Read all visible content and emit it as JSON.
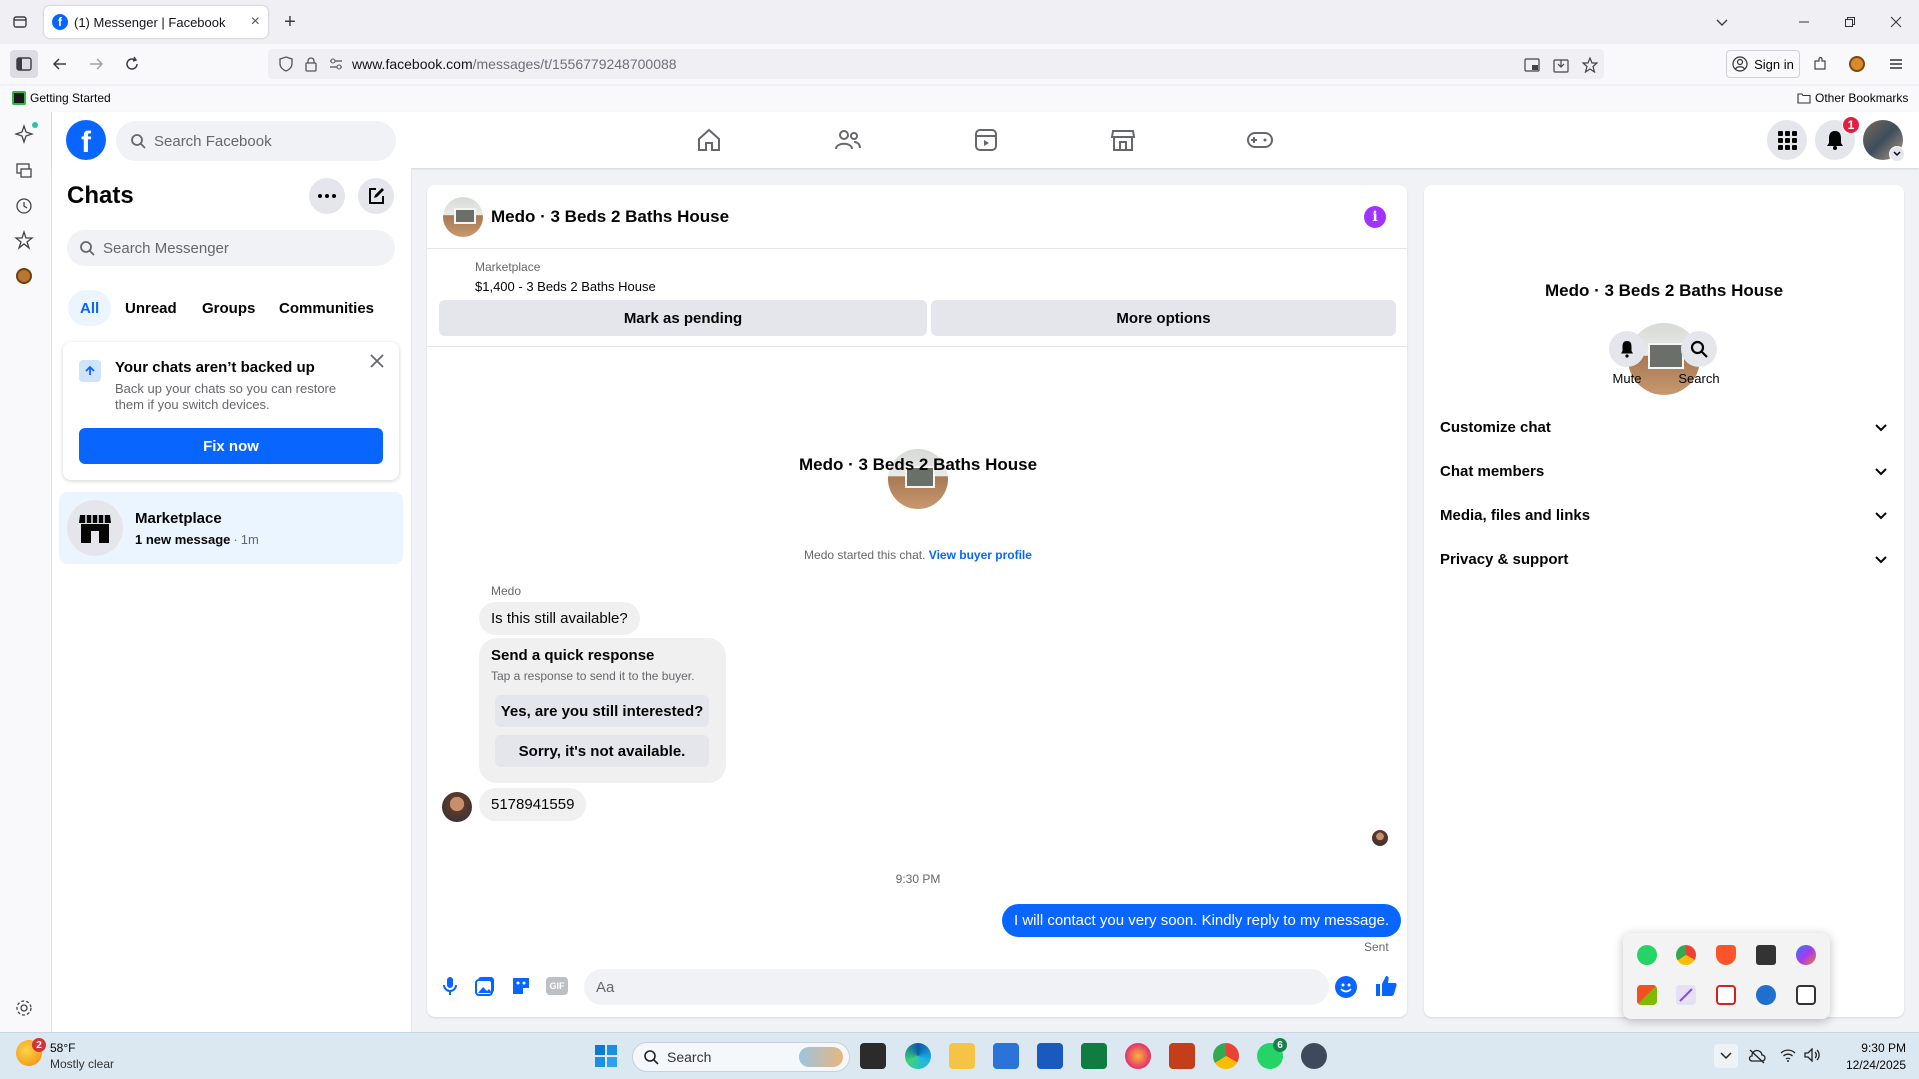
{
  "browser": {
    "tab_title": "(1) Messenger | Facebook",
    "url_host": "www.facebook.com",
    "url_path": "/messages/t/1556779248700088",
    "sign_in": "Sign in",
    "bookmark_getting_started": "Getting Started",
    "bookmark_other": "Other Bookmarks"
  },
  "fb_header": {
    "search_placeholder": "Search Facebook",
    "notification_count": "1"
  },
  "chats": {
    "title": "Chats",
    "search_placeholder": "Search Messenger",
    "filters": [
      "All",
      "Unread",
      "Groups",
      "Communities"
    ],
    "active_filter": "All",
    "backup": {
      "title": "Your chats aren’t backed up",
      "body": "Back up your chats so you can restore them if you switch devices.",
      "button": "Fix now"
    },
    "list": [
      {
        "name": "Marketplace",
        "preview": "1 new message",
        "time": "1m"
      }
    ]
  },
  "conversation": {
    "title": "Medo · 3 Beds 2 Baths House",
    "marketplace_label": "Marketplace",
    "listing": "$1,400 - 3 Beds 2 Baths House",
    "mark_pending": "Mark as pending",
    "more_options": "More options",
    "intro_name": "Medo · 3 Beds 2 Baths House",
    "started_text": "Medo started this chat.",
    "view_profile": "View buyer profile",
    "sender_name": "Medo",
    "msg1": "Is this still available?",
    "quick_title": "Send a quick response",
    "quick_sub": "Tap a response to send it to the buyer.",
    "quick_reply_1": "Yes, are you still interested?",
    "quick_reply_2": "Sorry, it's not available.",
    "msg2": "5178941559",
    "timestamp": "9:30 PM",
    "my_msg": "I will contact you very soon. Kindly reply to my message.",
    "status": "Sent",
    "composer_placeholder": "Aa"
  },
  "details": {
    "name": "Medo · 3 Beds 2 Baths House",
    "mute": "Mute",
    "search": "Search",
    "sections": [
      "Customize chat",
      "Chat members",
      "Media, files and links",
      "Privacy & support"
    ]
  },
  "taskbar": {
    "temp": "58°F",
    "weather": "Mostly clear",
    "weather_badge": "2",
    "search": "Search",
    "whatsapp_badge": "6",
    "time": "9:30 PM",
    "date": "12/24/2025"
  },
  "colors": {
    "fb_blue": "#0866ff",
    "fb_purple": "#a033ff",
    "bubble_blue": "#0866ff",
    "notif_red": "#e41e3f"
  }
}
